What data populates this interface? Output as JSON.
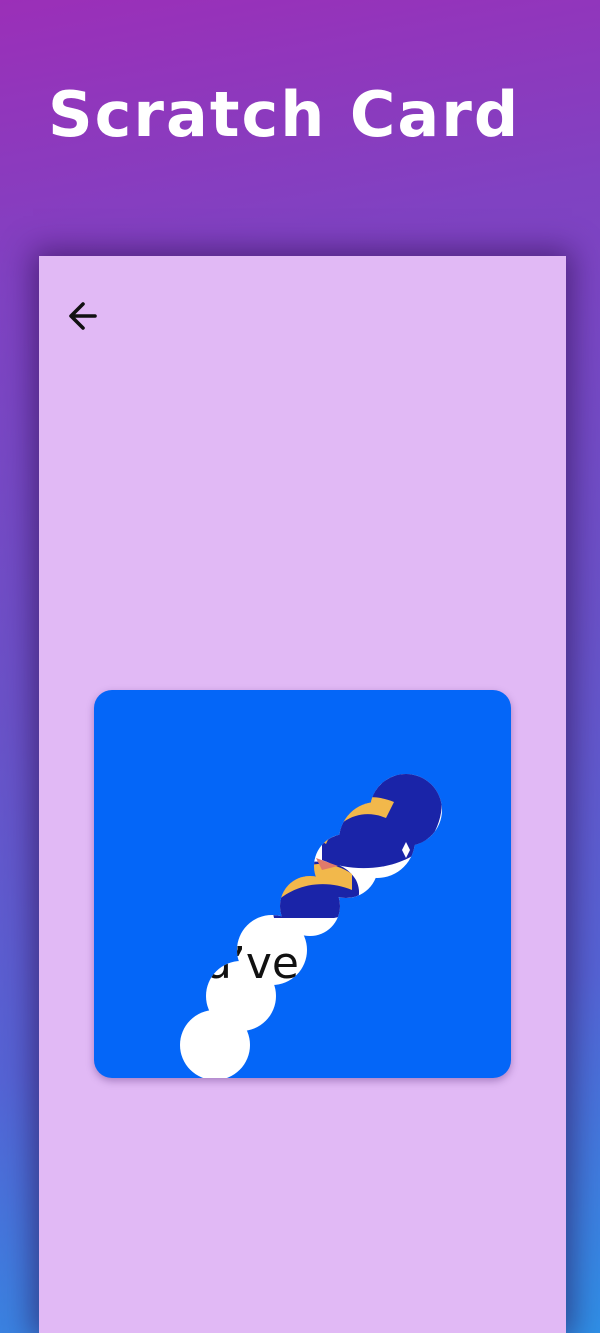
{
  "header": {
    "title": "Scratch Card"
  },
  "toolbar": {
    "back_icon": "arrow-left-icon"
  },
  "scratch_card": {
    "revealed_text": "u’ve",
    "cover_color": "#0466f8",
    "revealed_background": "#ffffff",
    "prize_icon": "hat-icon"
  },
  "colors": {
    "screen_background": "#e1b9f5",
    "accent_gold": "#f2b84b",
    "accent_navy": "#1a24a8"
  }
}
